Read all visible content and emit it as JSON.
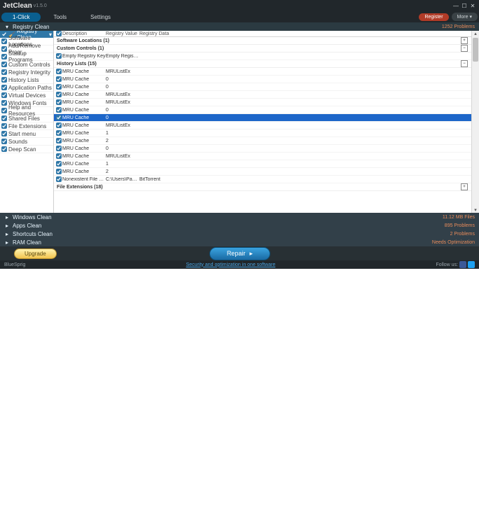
{
  "titlebar": {
    "app": "JetClean",
    "version": "v1.5.0"
  },
  "tabs": {
    "one_click": "1-Click",
    "tools": "Tools",
    "settings": "Settings"
  },
  "buttons": {
    "register": "Register",
    "more": "More",
    "upgrade": "Upgrade",
    "repair": "Repair"
  },
  "sections": {
    "registry": {
      "label": "Registry Clean",
      "right": "1252  Problems"
    },
    "windows": {
      "label": "Windows Clean",
      "right": "11.12 MB  Files"
    },
    "apps": {
      "label": "Apps Clean",
      "right": "895  Problems"
    },
    "shortcuts": {
      "label": "Shortcuts Clean",
      "right": "2  Problems"
    },
    "ram": {
      "label": "RAM Clean",
      "right": "Needs Optimization"
    }
  },
  "sidebar": {
    "head": "Registry Clean",
    "items": [
      "Software Locations",
      "Add/Remove Progr...",
      "Startup Programs",
      "Custom Controls",
      "Registry Integrity",
      "History Lists",
      "Application Paths",
      "Virtual Devices",
      "Windows Fonts",
      "Help and Resources",
      "Shared Files",
      "File Extensions",
      "Start menu",
      "Sounds",
      "Deep Scan"
    ]
  },
  "cols": {
    "desc": "Description",
    "val": "Registry Value",
    "data": "Registry Data"
  },
  "groups": {
    "sw": "Software Locations (1)",
    "cc": "Custom Controls (1)",
    "hl": "History Lists (15)",
    "fe": "File Extensions (18)"
  },
  "rows": {
    "custom": [
      {
        "desc": "Empty Registry Key",
        "val": "Empty Registry Value",
        "data": ""
      }
    ],
    "history": [
      {
        "desc": "MRU Cache",
        "val": "MRUListEx",
        "data": ""
      },
      {
        "desc": "MRU Cache",
        "val": "0",
        "data": ""
      },
      {
        "desc": "MRU Cache",
        "val": "0",
        "data": ""
      },
      {
        "desc": "MRU Cache",
        "val": "MRUListEx",
        "data": ""
      },
      {
        "desc": "MRU Cache",
        "val": "MRUListEx",
        "data": ""
      },
      {
        "desc": "MRU Cache",
        "val": "0",
        "data": ""
      },
      {
        "desc": "MRU Cache",
        "val": "0",
        "data": "",
        "selected": true
      },
      {
        "desc": "MRU Cache",
        "val": "MRUListEx",
        "data": ""
      },
      {
        "desc": "MRU Cache",
        "val": "1",
        "data": ""
      },
      {
        "desc": "MRU Cache",
        "val": "2",
        "data": ""
      },
      {
        "desc": "MRU Cache",
        "val": "0",
        "data": ""
      },
      {
        "desc": "MRU Cache",
        "val": "MRUListEx",
        "data": ""
      },
      {
        "desc": "MRU Cache",
        "val": "1",
        "data": ""
      },
      {
        "desc": "MRU Cache",
        "val": "2",
        "data": ""
      },
      {
        "desc": "Nonexistent File Path",
        "val": "C:\\Users\\Pamela\\A...",
        "data": "BitTorrent"
      }
    ]
  },
  "status": {
    "brand": "BlueSprig",
    "link": "Security and optimization in one software",
    "follow": "Follow us:"
  }
}
